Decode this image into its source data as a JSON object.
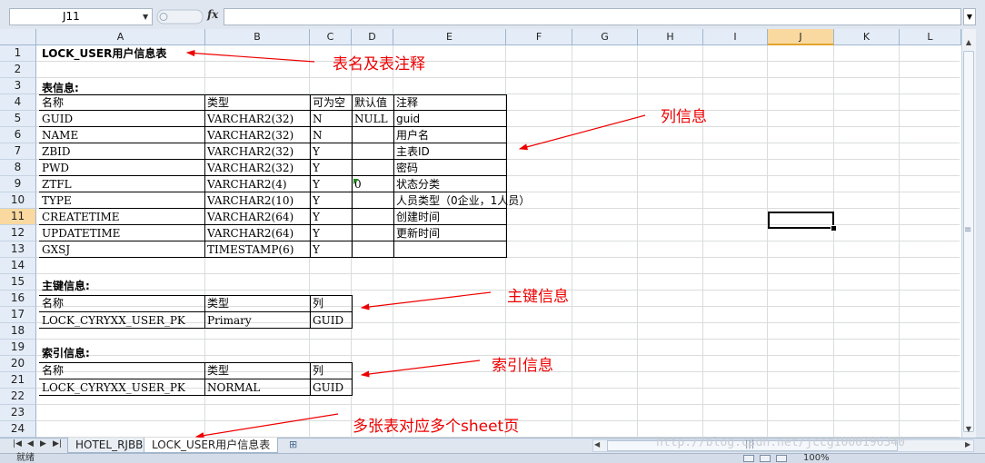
{
  "formula_bar": {
    "cell_ref": "J11",
    "fx_label": "fx",
    "formula": ""
  },
  "columns": [
    "A",
    "B",
    "C",
    "D",
    "E",
    "F",
    "G",
    "H",
    "I",
    "J",
    "K",
    "L"
  ],
  "selected_column": "J",
  "rows": [
    "1",
    "2",
    "3",
    "4",
    "5",
    "6",
    "7",
    "8",
    "9",
    "10",
    "11",
    "12",
    "13",
    "14",
    "15",
    "16",
    "17",
    "18",
    "19",
    "20",
    "21",
    "22",
    "23",
    "24"
  ],
  "selected_row": "11",
  "sheet": {
    "title": "LOCK_USER用户信息表",
    "table_info_heading": "表信息:",
    "table_headers": [
      "名称",
      "类型",
      "可为空",
      "默认值",
      "注释"
    ],
    "table_rows": [
      {
        "name": "GUID",
        "type": "VARCHAR2(32)",
        "nullable": "N",
        "default": "NULL",
        "comment": "guid"
      },
      {
        "name": "NAME",
        "type": "VARCHAR2(32)",
        "nullable": "N",
        "default": "",
        "comment": "用户名"
      },
      {
        "name": "ZBID",
        "type": "VARCHAR2(32)",
        "nullable": "Y",
        "default": "",
        "comment": "主表ID"
      },
      {
        "name": "PWD",
        "type": "VARCHAR2(32)",
        "nullable": "Y",
        "default": "",
        "comment": "密码"
      },
      {
        "name": "ZTFL",
        "type": "VARCHAR2(4)",
        "nullable": "Y",
        "default": "0",
        "comment": "状态分类"
      },
      {
        "name": "TYPE",
        "type": "VARCHAR2(10)",
        "nullable": "Y",
        "default": "",
        "comment": "人员类型（0企业，1人员）"
      },
      {
        "name": "CREATETIME",
        "type": "VARCHAR2(64)",
        "nullable": "Y",
        "default": "",
        "comment": "创建时间"
      },
      {
        "name": "UPDATETIME",
        "type": "VARCHAR2(64)",
        "nullable": "Y",
        "default": "",
        "comment": "更新时间"
      },
      {
        "name": "GXSJ",
        "type": "TIMESTAMP(6)",
        "nullable": "Y",
        "default": "",
        "comment": ""
      }
    ],
    "pk_heading": "主键信息:",
    "pk_headers": [
      "名称",
      "类型",
      "列"
    ],
    "pk_row": [
      "LOCK_CYRYXX_USER_PK",
      "Primary",
      "GUID"
    ],
    "index_heading": "索引信息:",
    "index_headers": [
      "名称",
      "类型",
      "列"
    ],
    "index_row": [
      "LOCK_CYRYXX_USER_PK",
      "NORMAL",
      "GUID"
    ]
  },
  "annotations": {
    "title_note": "表名及表注释",
    "column_note": "列信息",
    "pk_note": "主键信息",
    "index_note": "索引信息",
    "sheets_note": "多张表对应多个sheet页"
  },
  "tabs": [
    {
      "label": "HOTEL_RJBB",
      "active": false
    },
    {
      "label": "LOCK_USER用户信息表",
      "active": true
    }
  ],
  "status": {
    "ready": "就绪",
    "zoom": "100%"
  },
  "watermark": "http://blog.csdn.net/jccg1000196340",
  "colors": {
    "annotation": "#e00000",
    "header_bg": "#e4ecf7",
    "selected_header": "#f9d99f"
  }
}
